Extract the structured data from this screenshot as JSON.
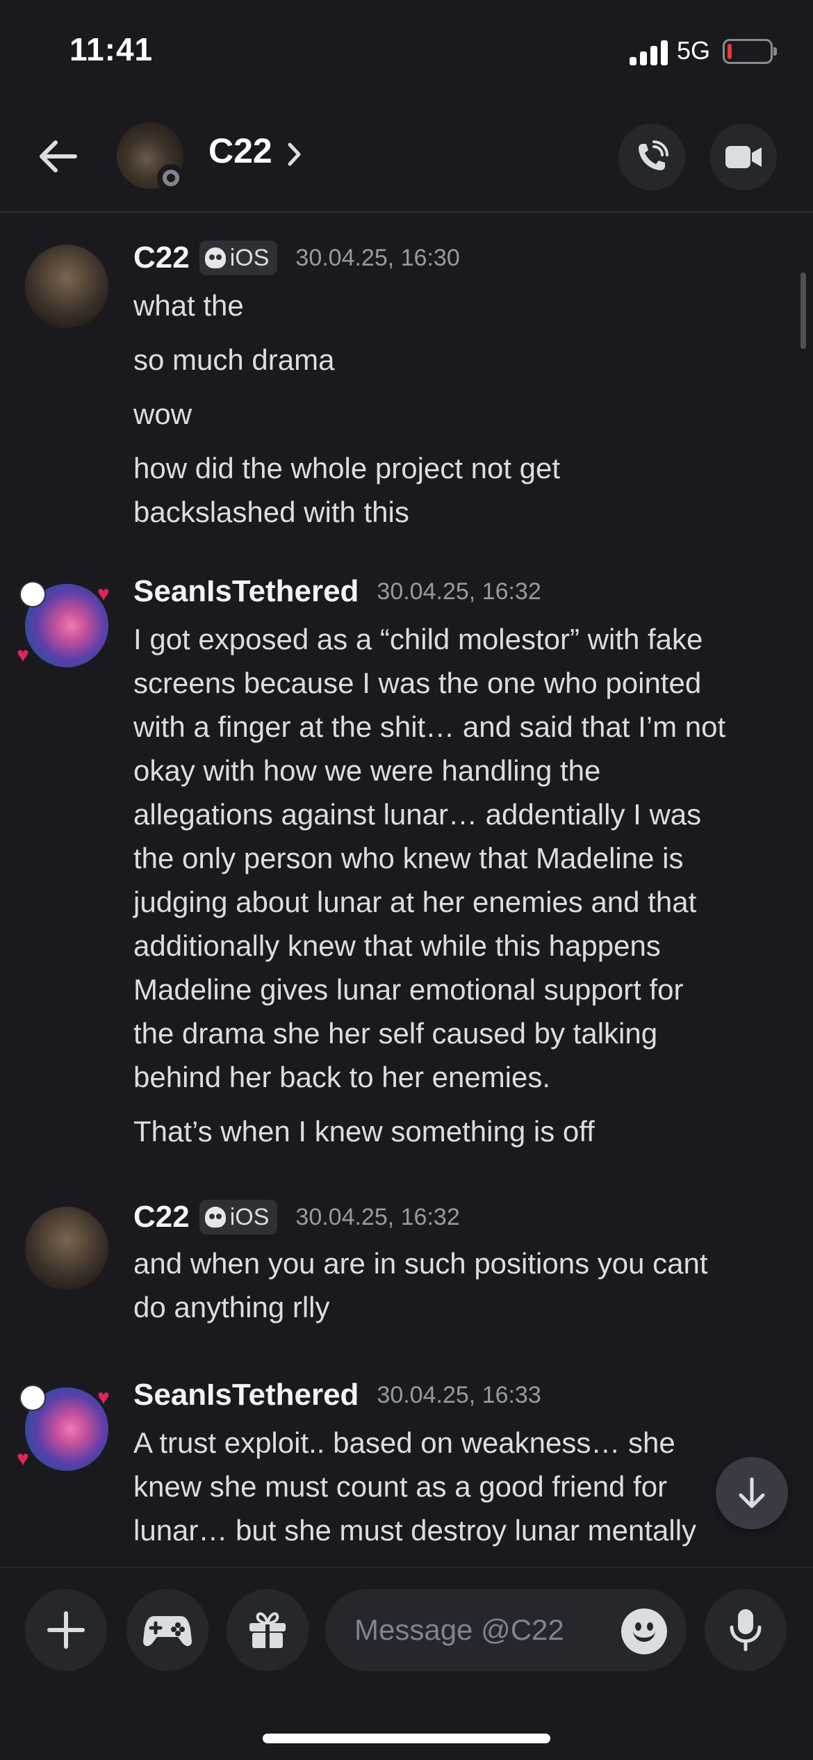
{
  "status_bar": {
    "time": "11:41",
    "network": "5G",
    "battery_percent": 10
  },
  "header": {
    "name": "C22"
  },
  "messages": [
    {
      "author": "C22",
      "tag": "iOS",
      "timestamp": "30.04.25, 16:30",
      "lines": [
        "what the",
        "so much drama",
        "wow",
        "how did the whole project not get",
        "backslashed with this"
      ]
    },
    {
      "author": "SeanIsTethered",
      "timestamp": "30.04.25, 16:32",
      "lines": [
        "I got exposed as a “child molestor” with fake",
        "screens because I was the one who pointed",
        "with a finger at the shit… and said that I’m not",
        "okay with how we were handling the",
        "allegations against lunar… addentially I was",
        "the only person who knew that Madeline is",
        "judging about lunar at her enemies and that",
        "additionally knew that while this happens",
        "Madeline gives lunar emotional support for",
        "the drama she her self caused by talking",
        "behind her back to her enemies.",
        "That’s when I knew something is off"
      ]
    },
    {
      "author": "C22",
      "tag": "iOS",
      "timestamp": "30.04.25, 16:32",
      "lines": [
        "and when you are in such positions you cant",
        "do anything rlly"
      ]
    },
    {
      "author": "SeanIsTethered",
      "timestamp": "30.04.25, 16:33",
      "lines": [
        "A trust exploit.. based on weakness… she",
        "knew she must count as a good friend for",
        "lunar… but she must destroy lunar mentally"
      ]
    }
  ],
  "composer": {
    "placeholder": "Message @C22"
  },
  "icons": {
    "back": "arrow-left-icon",
    "chevron": "chevron-right-icon",
    "call": "phone-call-icon",
    "video": "video-camera-icon",
    "jump": "arrow-down-icon",
    "plus": "plus-icon",
    "game": "gamepad-icon",
    "gift": "gift-icon",
    "emoji": "emoji-icon",
    "mic": "microphone-icon"
  },
  "colors": {
    "background": "#1a1a1e",
    "surface": "#26272d",
    "text": "#dbdee1",
    "muted": "#949ba4"
  }
}
